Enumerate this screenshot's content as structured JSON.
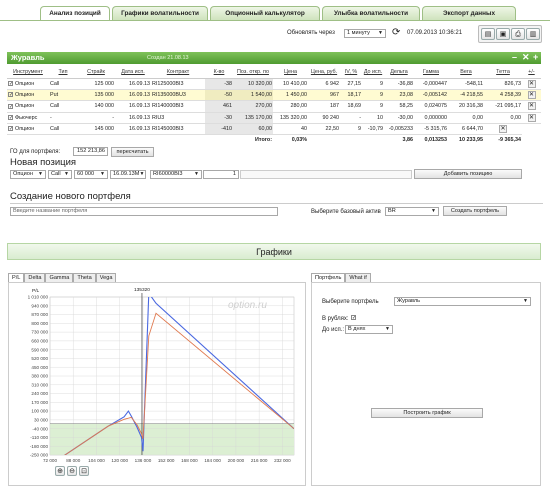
{
  "tabs": [
    "Анализ позиций",
    "Графики волатильности",
    "Опционный калькулятор",
    "Улыбка волатильности",
    "Экспорт данных"
  ],
  "toolbar": {
    "refresh_label": "Обновлять через",
    "refresh_interval": "1 минуту",
    "datetime": "07.09.2013 10:36:21"
  },
  "portfolio": {
    "name": "Журавль",
    "created": "Создан 21.08.13"
  },
  "table": {
    "columns": [
      "Инструмент",
      "Тип",
      "Страйк",
      "Дата исп.",
      "Контракт",
      "К-во",
      "Поз. откр. по",
      "Цена",
      "Цена, руб.",
      "IV, %",
      "До исп.",
      "Дельта",
      "Гамма",
      "Вега",
      "Тетта",
      "+/-"
    ],
    "rows": [
      [
        "Опцион",
        "Call",
        "125 000",
        "16.09.13",
        "RI125000BI3",
        "-38",
        "10 320,00",
        "10 410,00",
        "6 942",
        "27,15",
        "9",
        "-36,88",
        "-0,000447",
        "-548,11",
        "826,73"
      ],
      [
        "Опцион",
        "Put",
        "135 000",
        "16.09.13",
        "RI135000BU3",
        "-50",
        "1 540,00",
        "1 450,00",
        "967",
        "18,17",
        "9",
        "23,08",
        "-0,005142",
        "-4 218,55",
        "4 258,39"
      ],
      [
        "Опцион",
        "Call",
        "140 000",
        "16.09.13",
        "RI140000BI3",
        "461",
        "270,00",
        "280,00",
        "187",
        "18,69",
        "9",
        "58,25",
        "0,024075",
        "20 316,38",
        "-21 095,17"
      ],
      [
        "Фьючерс",
        "-",
        "-",
        "16.09.13",
        "RIU3",
        "-30",
        "135 170,00",
        "135 320,00",
        "90 240",
        "-",
        "10",
        "-30,00",
        "0,000000",
        "0,00",
        "0,00"
      ],
      [
        "Опцион",
        "Call",
        "145 000",
        "16.09.13",
        "RI145000BI3",
        "-410",
        "60,00",
        "40",
        "22,50",
        "9",
        "-10,79",
        "-0,005233",
        "-5 315,76",
        "6 644,70"
      ]
    ],
    "total_label": "Итого:",
    "total_price": "0,03%",
    "totals": [
      "3,86",
      "0,013253",
      "10 233,95",
      "-9 365,34"
    ]
  },
  "go": {
    "label": "ГО для портфеля:",
    "value": "152 213,86",
    "recalc": "пересчитать"
  },
  "new_position": {
    "title": "Новая позиция",
    "instrument": "Опцион",
    "type": "Call",
    "strike": "60 000",
    "date": "16.09.13M",
    "contract": "RI60000BI3",
    "qty": "1",
    "add": "Добавить позицию"
  },
  "new_portfolio": {
    "title": "Создание нового портфеля",
    "name_placeholder": "Введите название портфеля",
    "asset_label": "Выберите базовый актив",
    "asset": "BR",
    "create": "Создать портфель"
  },
  "charts": {
    "title": "Графики",
    "greek_tabs": [
      "P/L",
      "Delta",
      "Gamma",
      "Theta",
      "Vega"
    ],
    "right_tabs": [
      "Портфель",
      "What if"
    ],
    "select_label": "Выберите портфель",
    "select_value": "Журавль",
    "rub_label": "В рублях:",
    "days_label": "До исп.:",
    "days_value": "В днях",
    "build": "Построить график",
    "watermark": "option.ru"
  },
  "chart_data": {
    "type": "line",
    "ylabel": "P/L",
    "marker_label": "135320",
    "x_ticks": [
      "72 000",
      "88 000",
      "104 000",
      "120 000",
      "136 000",
      "152 000",
      "168 000",
      "184 000",
      "200 000",
      "216 000",
      "232 000"
    ],
    "y_ticks": [
      "1 010 000",
      "940 000",
      "870 000",
      "800 000",
      "730 000",
      "660 000",
      "590 000",
      "520 000",
      "450 000",
      "380 000",
      "310 000",
      "240 000",
      "170 000",
      "100 000",
      "30 000",
      "-40 000",
      "-110 000",
      "-180 000",
      "-250 000"
    ],
    "ylim": [
      -250000,
      1010000
    ],
    "xlim": [
      72000,
      240000
    ],
    "series": [
      {
        "color": "#4a68e0",
        "x": [
          72000,
          112000,
          123000,
          126000,
          128000,
          132000,
          135000,
          136000,
          140000,
          145000,
          240000
        ],
        "y": [
          -330000,
          -20000,
          55000,
          100000,
          60000,
          -30000,
          -110000,
          -220000,
          1040000,
          960000,
          -40000
        ]
      },
      {
        "color": "#e07a50",
        "x": [
          72000,
          112000,
          123000,
          128000,
          132000,
          135000,
          136000,
          140000,
          145000,
          240000
        ],
        "y": [
          -330000,
          -20000,
          35000,
          50000,
          -10000,
          -80000,
          -120000,
          700000,
          880000,
          -40000
        ]
      }
    ]
  }
}
